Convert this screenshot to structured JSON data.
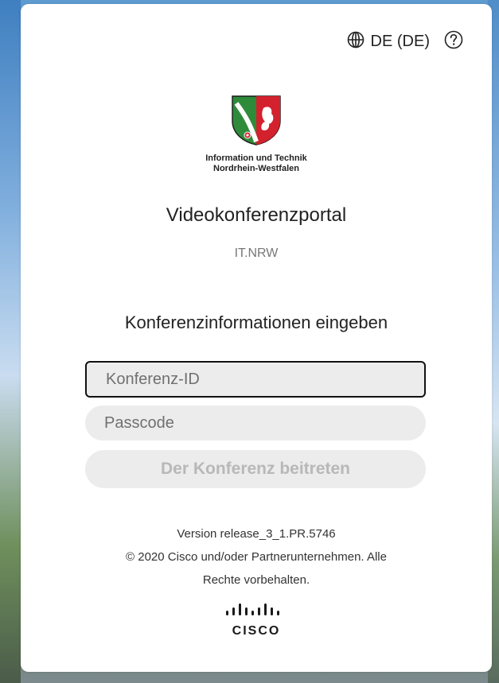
{
  "header": {
    "language_label": "DE (DE)",
    "language_icon": "globe-icon",
    "help_icon": "help-icon"
  },
  "logo": {
    "org_line1": "Information und Technik",
    "org_line2": "Nordrhein-Westfalen"
  },
  "portal": {
    "title": "Videokonferenzportal",
    "subtitle": "IT.NRW"
  },
  "form": {
    "heading": "Konferenzinformationen eingeben",
    "conference_id_placeholder": "Konferenz-ID",
    "conference_id_value": "",
    "passcode_placeholder": "Passcode",
    "passcode_value": "",
    "join_label": "Der Konferenz beitreten"
  },
  "footer": {
    "version": "Version release_3_1.PR.5746",
    "copyright_line1": "© 2020 Cisco und/oder Partnerunternehmen. Alle",
    "copyright_line2": "Rechte vorbehalten.",
    "brand": "CISCO"
  },
  "colors": {
    "card_bg": "#ffffff",
    "field_bg": "#ececec",
    "focus_border": "#111111",
    "disabled_text": "#b8b8b8"
  }
}
